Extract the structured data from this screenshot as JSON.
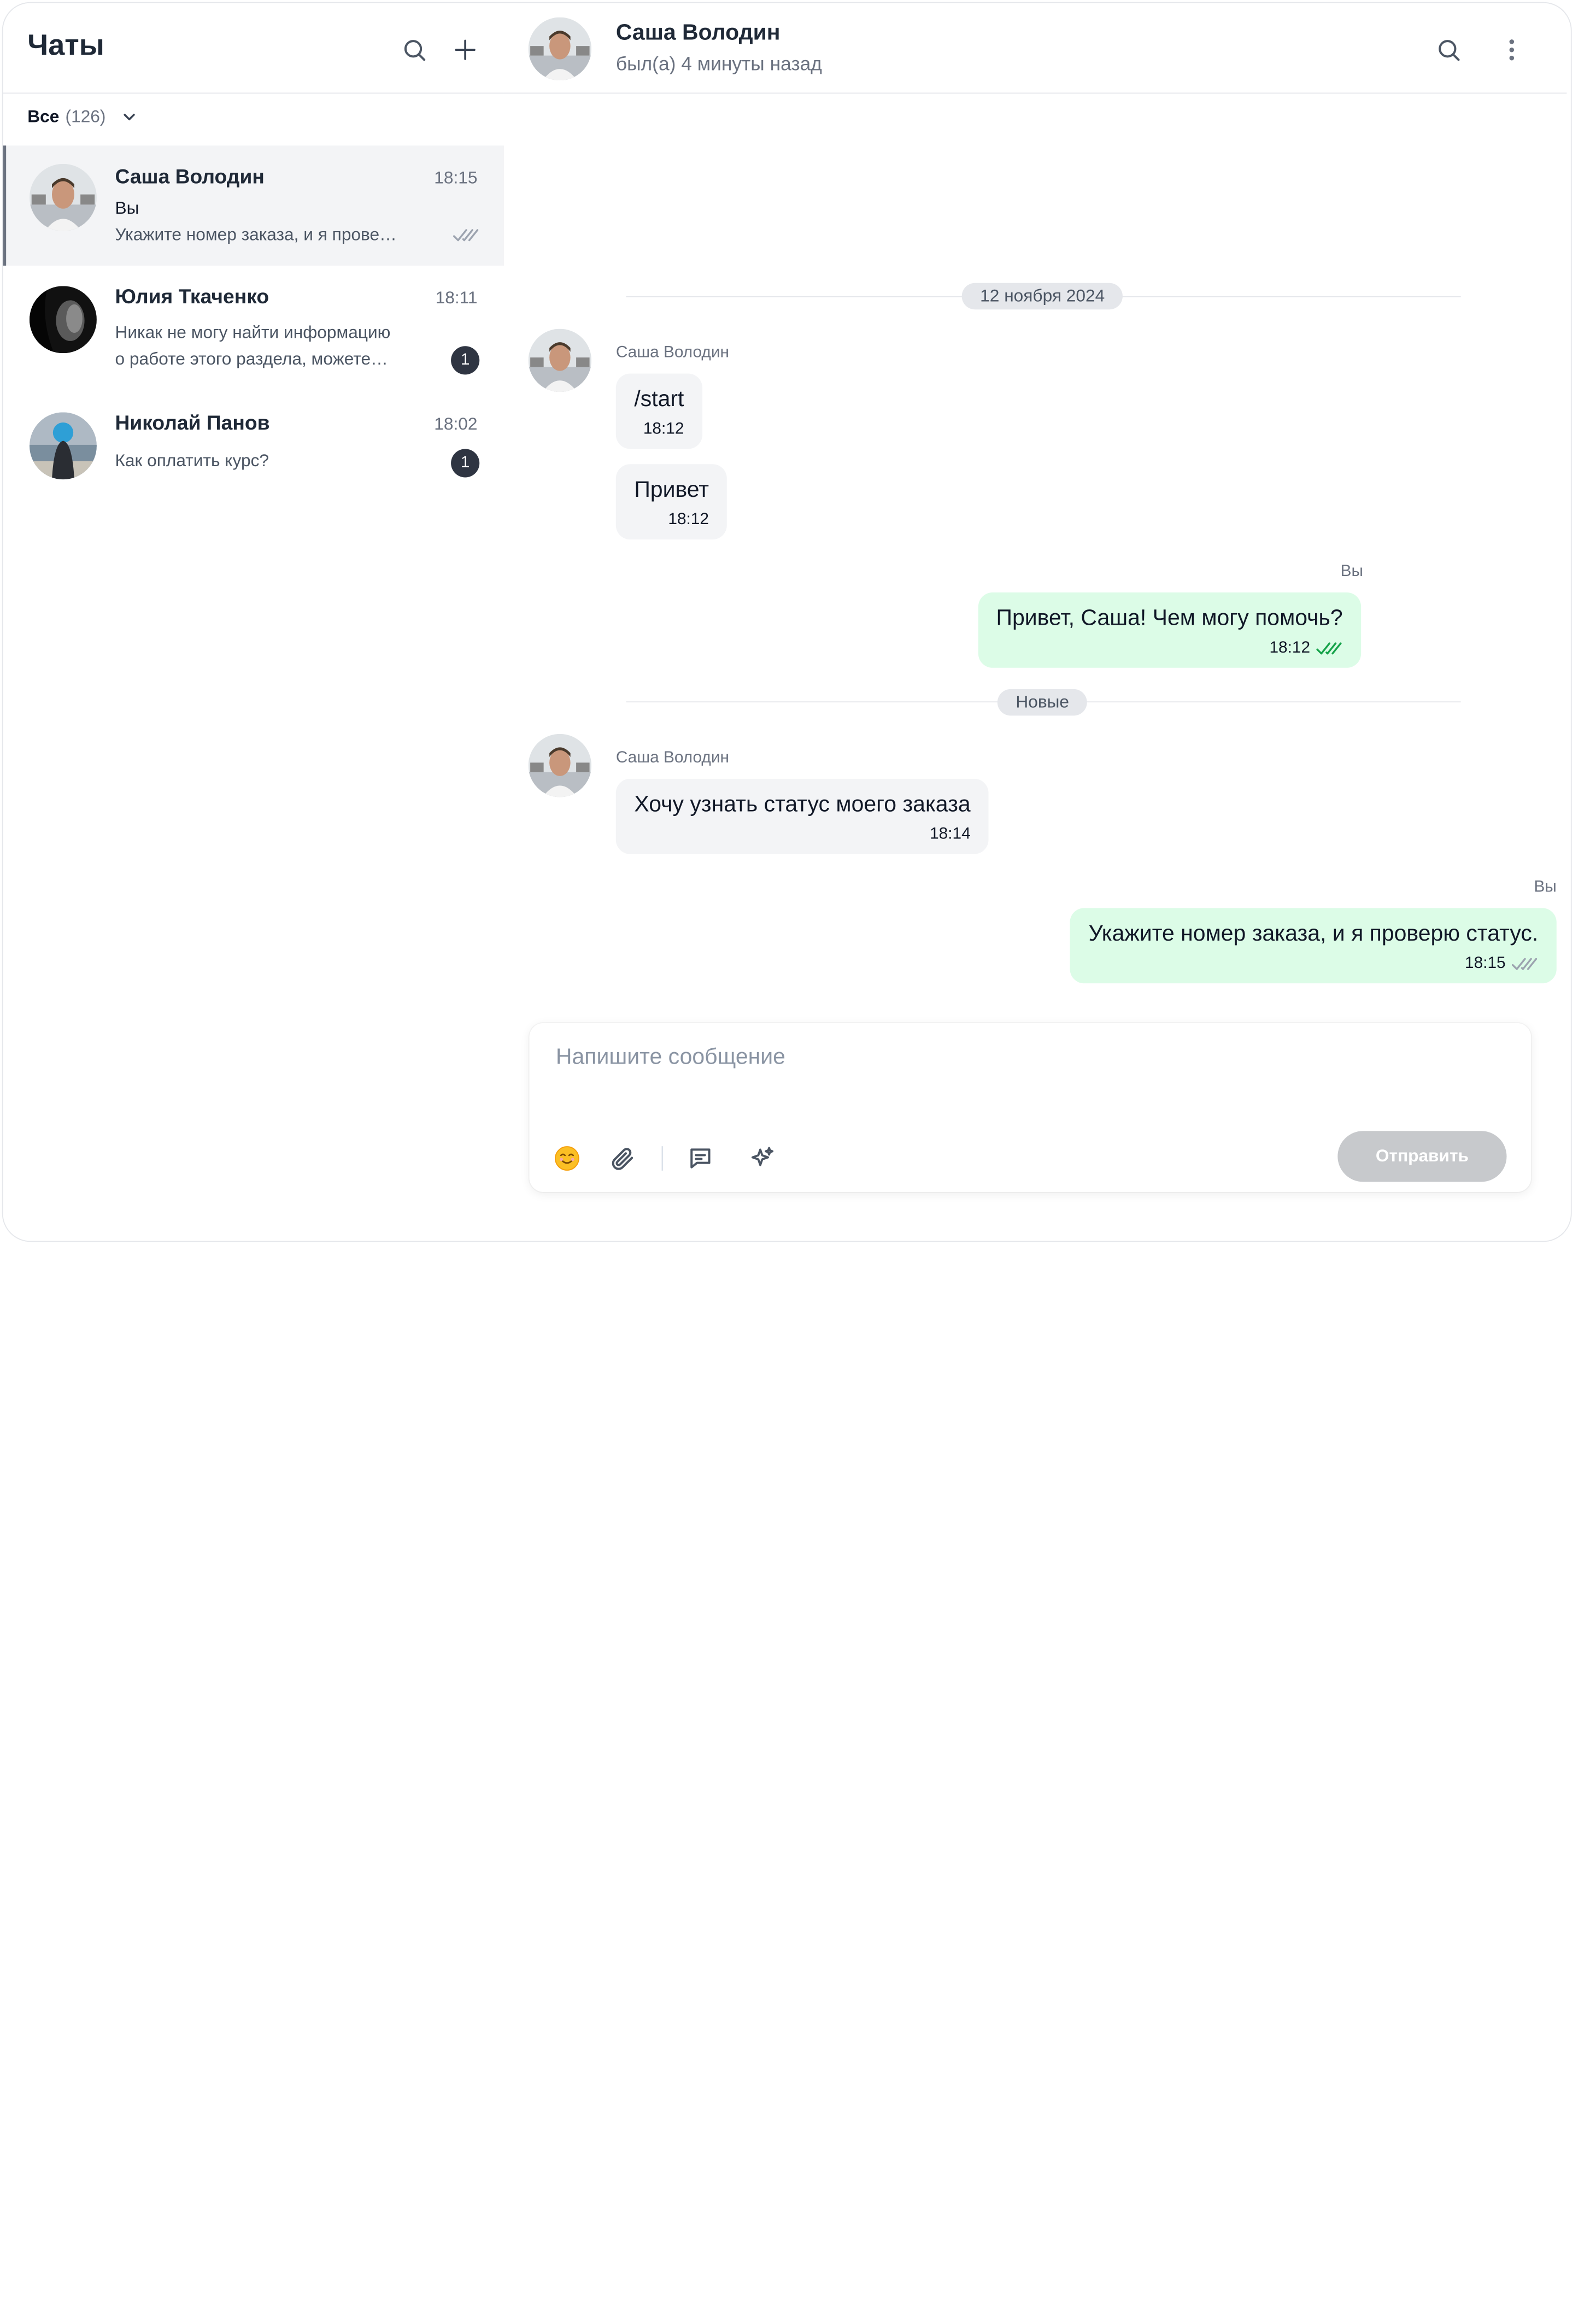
{
  "sidebar": {
    "title": "Чаты",
    "filter": {
      "label": "Все",
      "count": "(126)"
    },
    "chats": [
      {
        "name": "Саша Володин",
        "time": "18:15",
        "sender": "Вы",
        "preview": "Укажите номер заказа, и я прове…",
        "status": "read"
      },
      {
        "name": "Юлия Ткаченко",
        "time": "18:11",
        "preview_line1": "Никак не могу найти информацию",
        "preview_line2": "о работе этого раздела, можете…",
        "unread": "1"
      },
      {
        "name": "Николай Панов",
        "time": "18:02",
        "preview": "Как оплатить курс?",
        "unread": "1"
      }
    ]
  },
  "chat": {
    "name": "Саша Володин",
    "status": "был(а) 4 минуты назад",
    "date_separator": "12 ноября 2024",
    "new_separator": "Новые",
    "messages": [
      {
        "sender": "Саша Володин",
        "text": "/start",
        "time": "18:12"
      },
      {
        "text": "Привет",
        "time": "18:12"
      },
      {
        "sender": "Вы",
        "text": "Привет, Саша! Чем могу помочь?",
        "time": "18:12"
      },
      {
        "sender": "Саша Володин",
        "text": "Хочу узнать статус моего заказа",
        "time": "18:14"
      },
      {
        "sender": "Вы",
        "text": "Укажите номер заказа, и я проверю статус.",
        "time": "18:15"
      }
    ]
  },
  "composer": {
    "placeholder": "Напишите сообщение",
    "send_label": "Отправить"
  },
  "icons": {
    "search": "search-icon",
    "plus": "plus-icon",
    "more": "more-vertical-icon",
    "emoji": "emoji-icon",
    "attach": "paperclip-icon",
    "template": "message-template-icon",
    "ai": "sparkles-icon"
  },
  "colors": {
    "outgoing_bubble": "#dcfce7",
    "incoming_bubble": "#f3f4f6",
    "badge": "#2f3542",
    "read_check": "#16a34a"
  }
}
